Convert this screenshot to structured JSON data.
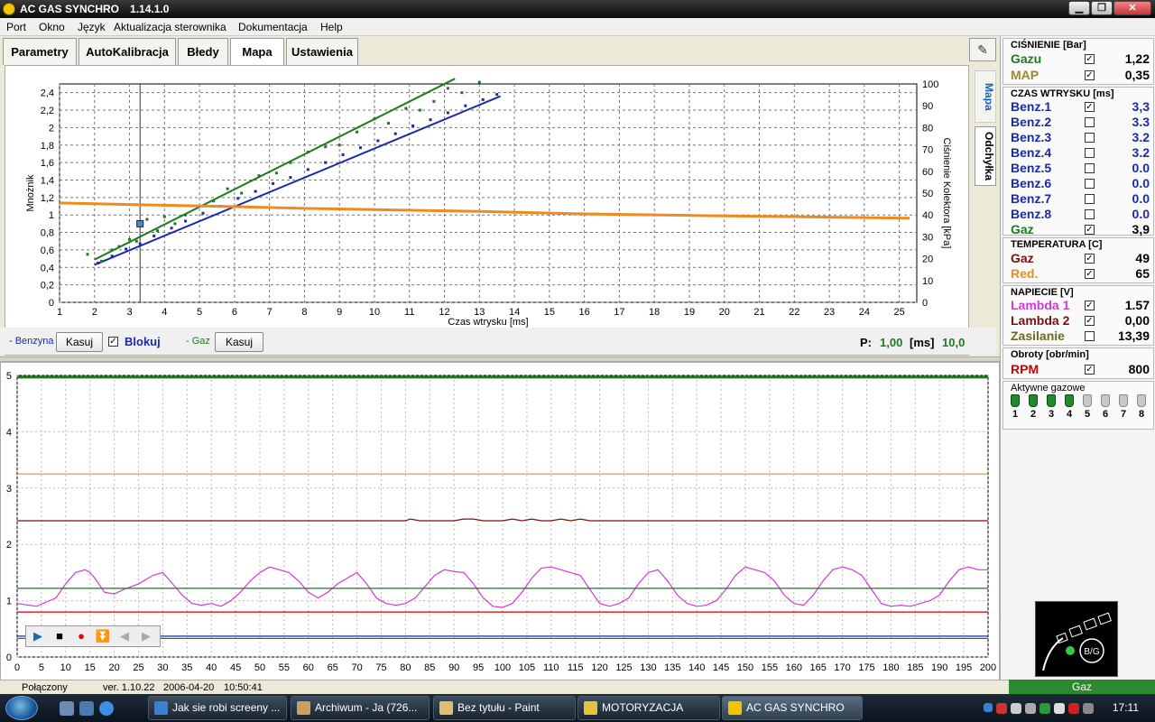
{
  "window": {
    "title": "AC GAS SYNCHRO",
    "version": "1.14.1.0",
    "controls": [
      "▁",
      "❐",
      "✕"
    ]
  },
  "menu": [
    "Port",
    "Okno",
    "Język",
    "Aktualizacja sterownika",
    "Dokumentacja",
    "Help"
  ],
  "tabs": [
    "Parametry",
    "AutoKalibracja",
    "Błedy",
    "Mapa",
    "Ustawienia"
  ],
  "active_tab": "Mapa",
  "side_tabs": {
    "mapa": "Mapa",
    "odchylka": "Odchyłka",
    "tool_icon": "wrench-icon"
  },
  "map_controls": {
    "benzyna_label": "- Benzyna",
    "kasuj1": "Kasuj",
    "blokuj": "Blokuj",
    "blokuj_checked": true,
    "gaz_label": "- Gaz",
    "kasuj2": "Kasuj",
    "p_label": "P:",
    "p_value": "1,00",
    "p_unit": "[ms]",
    "p_value2": "10,0"
  },
  "colors": {
    "benz": "#1b2aa8",
    "gaz": "#1f7a1f",
    "pressure": "#f08a1c",
    "lambda1": "#d23ad2",
    "lambda2": "#7a1010",
    "zasilanie": "#6b6b1c",
    "rpm": "#cc0000"
  },
  "chart_data": [
    {
      "type": "scatter",
      "title": "",
      "xlabel": "Czas wtrysku [ms]",
      "ylabel": "Mnożnik",
      "y2label": "Ciśnienie Kolektora [kPa]",
      "xlim": [
        1,
        25.5
      ],
      "ylim": [
        0,
        2.5
      ],
      "y2lim": [
        0,
        100
      ],
      "x_ticks": [
        "1",
        "2",
        "3",
        "4",
        "5",
        "6",
        "7",
        "8",
        "9",
        "10",
        "11",
        "12",
        "13",
        "14",
        "15",
        "16",
        "17",
        "18",
        "19",
        "20",
        "21",
        "22",
        "23",
        "24",
        "25"
      ],
      "y_ticks": [
        "0",
        "0,2",
        "0,4",
        "0,6",
        "0,8",
        "1",
        "1,2",
        "1,4",
        "1,6",
        "1,8",
        "2",
        "2,2",
        "2,4"
      ],
      "y2_ticks": [
        "0",
        "10",
        "20",
        "30",
        "40",
        "50",
        "60",
        "70",
        "80",
        "90",
        "100"
      ],
      "grid": true,
      "cursor_x": 3.3,
      "marker": {
        "x": 3.3,
        "y": 0.9
      },
      "series": [
        {
          "color": "#1f7a1f",
          "kind": "trend",
          "x": [
            2.0,
            12.3
          ],
          "y": [
            0.49,
            2.56
          ]
        },
        {
          "color": "#1b2aa8",
          "kind": "trend",
          "x": [
            2.0,
            13.6
          ],
          "y": [
            0.43,
            2.36
          ]
        },
        {
          "color": "#1f7a1f",
          "kind": "points",
          "x": [
            1.8,
            2.2,
            2.5,
            2.7,
            3.0,
            3.2,
            3.5,
            3.8,
            4.0,
            4.3,
            4.6,
            5.0,
            5.4,
            5.8,
            6.2,
            6.7,
            7.2,
            7.6,
            8.1,
            8.6,
            9.0,
            9.5,
            10.0,
            10.4,
            10.9,
            11.3,
            11.7,
            12.1,
            12.5,
            13.0
          ],
          "y": [
            0.55,
            0.47,
            0.6,
            0.64,
            0.72,
            0.7,
            0.95,
            0.82,
            0.98,
            0.9,
            1.0,
            1.1,
            1.16,
            1.3,
            1.25,
            1.45,
            1.48,
            1.6,
            1.72,
            1.78,
            1.8,
            1.95,
            2.1,
            2.05,
            2.22,
            2.2,
            2.3,
            2.45,
            2.4,
            2.52
          ]
        },
        {
          "color": "#1b2aa8",
          "kind": "points",
          "x": [
            2.1,
            2.5,
            2.9,
            3.3,
            3.7,
            4.2,
            4.6,
            5.1,
            5.6,
            6.1,
            6.6,
            7.1,
            7.6,
            8.1,
            8.6,
            9.1,
            9.6,
            10.1,
            10.6,
            11.1,
            11.6,
            12.1,
            12.6,
            13.1,
            13.5
          ],
          "y": [
            0.45,
            0.53,
            0.61,
            0.67,
            0.76,
            0.85,
            0.93,
            1.02,
            1.1,
            1.19,
            1.27,
            1.36,
            1.43,
            1.52,
            1.6,
            1.69,
            1.77,
            1.85,
            1.93,
            2.02,
            2.09,
            2.17,
            2.25,
            2.32,
            2.38
          ]
        },
        {
          "color": "#f08a1c",
          "kind": "line",
          "axis": "y2",
          "x": [
            1,
            3,
            6,
            8,
            10,
            13,
            16,
            19,
            22,
            25.3
          ],
          "y": [
            45.5,
            44.8,
            43.8,
            43.0,
            42.5,
            41.6,
            40.5,
            39.8,
            39.2,
            38.5
          ]
        }
      ]
    },
    {
      "type": "line",
      "title": "",
      "xlim": [
        0,
        200
      ],
      "ylim": [
        0,
        5
      ],
      "x_ticks": [
        "0",
        "5",
        "10",
        "15",
        "20",
        "25",
        "30",
        "35",
        "40",
        "45",
        "50",
        "55",
        "60",
        "65",
        "70",
        "75",
        "80",
        "85",
        "90",
        "95",
        "100",
        "105",
        "110",
        "115",
        "120",
        "125",
        "130",
        "135",
        "140",
        "145",
        "150",
        "155",
        "160",
        "165",
        "170",
        "175",
        "180",
        "185",
        "190",
        "195",
        "200"
      ],
      "y_ticks": [
        "0",
        "1",
        "2",
        "3",
        "4",
        "5"
      ],
      "grid": true,
      "series": [
        {
          "color": "#1f7a1f",
          "x": [
            0,
            200
          ],
          "y": [
            4.97,
            4.97
          ]
        },
        {
          "color": "#f08a1c",
          "x": [
            0,
            200
          ],
          "y": [
            3.25,
            3.25
          ]
        },
        {
          "color": "#7a1010",
          "x": [
            0,
            80,
            81,
            83,
            90,
            92,
            94,
            96,
            100,
            102,
            104,
            106,
            108,
            110,
            112,
            114,
            116,
            118,
            120,
            200
          ],
          "y": [
            2.42,
            2.42,
            2.45,
            2.42,
            2.42,
            2.45,
            2.45,
            2.42,
            2.42,
            2.45,
            2.42,
            2.45,
            2.42,
            2.42,
            2.45,
            2.42,
            2.45,
            2.42,
            2.42,
            2.42
          ]
        },
        {
          "color": "#d23ad2",
          "x": [
            0,
            4,
            8,
            10,
            12,
            14,
            15,
            16,
            18,
            20,
            22,
            25,
            28,
            30,
            32,
            34,
            36,
            38,
            40,
            42,
            44,
            46,
            48,
            50,
            52,
            54,
            56,
            58,
            60,
            62,
            64,
            66,
            68,
            70,
            72,
            74,
            76,
            78,
            80,
            82,
            84,
            86,
            88,
            90,
            92,
            94,
            96,
            98,
            100,
            102,
            104,
            106,
            108,
            110,
            112,
            114,
            116,
            118,
            120,
            122,
            124,
            126,
            128,
            130,
            132,
            134,
            136,
            138,
            140,
            142,
            144,
            146,
            148,
            150,
            152,
            154,
            156,
            158,
            160,
            162,
            164,
            166,
            168,
            170,
            172,
            174,
            176,
            178,
            180,
            182,
            184,
            186,
            188,
            190,
            192,
            194,
            196,
            198,
            200
          ],
          "y": [
            0.95,
            0.9,
            1.05,
            1.3,
            1.5,
            1.55,
            1.5,
            1.4,
            1.15,
            1.12,
            1.2,
            1.3,
            1.45,
            1.5,
            1.3,
            1.1,
            0.95,
            0.92,
            0.95,
            0.9,
            1.0,
            1.15,
            1.35,
            1.5,
            1.6,
            1.55,
            1.5,
            1.35,
            1.15,
            1.05,
            1.15,
            1.3,
            1.4,
            1.5,
            1.3,
            1.05,
            0.95,
            0.92,
            0.95,
            1.05,
            1.25,
            1.45,
            1.55,
            1.52,
            1.5,
            1.3,
            1.05,
            0.9,
            0.88,
            0.95,
            1.15,
            1.4,
            1.58,
            1.6,
            1.55,
            1.5,
            1.45,
            1.2,
            0.95,
            0.9,
            0.95,
            1.05,
            1.3,
            1.5,
            1.55,
            1.35,
            1.1,
            0.95,
            0.9,
            0.92,
            1.0,
            1.2,
            1.45,
            1.6,
            1.55,
            1.5,
            1.35,
            1.1,
            0.95,
            0.92,
            1.1,
            1.35,
            1.55,
            1.6,
            1.55,
            1.45,
            1.2,
            0.95,
            0.9,
            0.92,
            0.9,
            0.95,
            1.0,
            1.1,
            1.35,
            1.55,
            1.6,
            1.55,
            1.55
          ]
        },
        {
          "color": "#1f7a1f",
          "x": [
            0,
            200
          ],
          "y": [
            1.22,
            1.22
          ]
        },
        {
          "color": "#cc0000",
          "x": [
            0,
            200
          ],
          "y": [
            0.8,
            0.8
          ]
        },
        {
          "color": "#1b2aa8",
          "x": [
            0,
            200
          ],
          "y": [
            0.37,
            0.37
          ]
        },
        {
          "color": "#1f7a1f",
          "x": [
            0,
            200
          ],
          "y": [
            0.33,
            0.33
          ]
        }
      ]
    }
  ],
  "panel": {
    "pressure": {
      "title": "CIŚNIENIE [Bar]",
      "rows": [
        {
          "label": "Gazu",
          "value": "1,22",
          "checked": true,
          "color": "#1f7a1f"
        },
        {
          "label": "MAP",
          "value": "0,35",
          "checked": true,
          "color": "#9a8a28"
        }
      ]
    },
    "injection": {
      "title": "CZAS WTRYSKU  [ms]",
      "rows": [
        {
          "label": "Benz.1",
          "value": "3,3",
          "checked": true,
          "color": "#1b2aa8"
        },
        {
          "label": "Benz.2",
          "value": "3.3",
          "checked": false,
          "color": "#1b2aa8"
        },
        {
          "label": "Benz.3",
          "value": "3.2",
          "checked": false,
          "color": "#1b2aa8"
        },
        {
          "label": "Benz.4",
          "value": "3.2",
          "checked": false,
          "color": "#1b2aa8"
        },
        {
          "label": "Benz.5",
          "value": "0.0",
          "checked": false,
          "color": "#1b2aa8"
        },
        {
          "label": "Benz.6",
          "value": "0.0",
          "checked": false,
          "color": "#1b2aa8"
        },
        {
          "label": "Benz.7",
          "value": "0.0",
          "checked": false,
          "color": "#1b2aa8"
        },
        {
          "label": "Benz.8",
          "value": "0.0",
          "checked": false,
          "color": "#1b2aa8"
        },
        {
          "label": "Gaz",
          "value": "3,9",
          "checked": true,
          "color": "#1f7a1f"
        }
      ]
    },
    "temperature": {
      "title": "TEMPERATURA  [C]",
      "rows": [
        {
          "label": "Gaz",
          "value": "49",
          "checked": true,
          "color": "#7a1010"
        },
        {
          "label": "Red.",
          "value": "65",
          "checked": true,
          "color": "#f08a1c"
        }
      ]
    },
    "voltage": {
      "title": "NAPIECIE [V]",
      "rows": [
        {
          "label": "Lambda 1",
          "value": "1.57",
          "checked": true,
          "color": "#d23ad2"
        },
        {
          "label": "Lambda 2",
          "value": "0,00",
          "checked": true,
          "color": "#7a1010"
        },
        {
          "label": "Zasilanie",
          "value": "13,39",
          "checked": false,
          "color": "#6b6b1c"
        }
      ]
    },
    "rpm": {
      "title": "Obroty [obr/min]",
      "rows": [
        {
          "label": "RPM",
          "value": "800",
          "checked": true,
          "color": "#cc0000"
        }
      ]
    },
    "active_injectors": {
      "title": "Aktywne gazowe",
      "items": [
        {
          "n": "1",
          "active": true
        },
        {
          "n": "2",
          "active": true
        },
        {
          "n": "3",
          "active": true
        },
        {
          "n": "4",
          "active": true
        },
        {
          "n": "5",
          "active": false
        },
        {
          "n": "6",
          "active": false
        },
        {
          "n": "7",
          "active": false
        },
        {
          "n": "8",
          "active": false
        }
      ]
    },
    "logo_text": "B/G"
  },
  "status": {
    "connection": "Połączony",
    "version": "ver. 1.10.22",
    "date": "2006-04-20",
    "time": "10:50:41",
    "mode": "Gaz"
  },
  "media": [
    "play-icon",
    "stop-icon",
    "record-icon",
    "download-icon",
    "prev-icon",
    "next-icon"
  ],
  "taskbar": {
    "buttons": [
      {
        "label": "Jak sie robi screeny ...",
        "color": "#3c7fd3"
      },
      {
        "label": "Archiwum - Ja (726...",
        "color": "#c8a060"
      },
      {
        "label": "Bez tytułu - Paint",
        "color": "#e0c070"
      },
      {
        "label": "MOTORYZACJA",
        "color": "#e6c23a"
      },
      {
        "label": "AC GAS SYNCHRO",
        "color": "#f3c400",
        "active": true
      }
    ],
    "clock": "17:11"
  }
}
